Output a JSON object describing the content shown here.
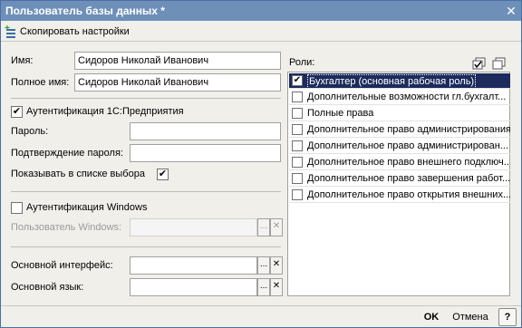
{
  "window": {
    "title": "Пользователь базы данных *",
    "close_glyph": "✕"
  },
  "toolbar": {
    "copy_label": "Скопировать настройки"
  },
  "form": {
    "name_label": "Имя:",
    "name_value": "Сидоров Николай Иванович",
    "fullname_label": "Полное имя:",
    "fullname_value": "Сидоров Николай Иванович",
    "auth_1c_label": "Аутентификация 1С:Предприятия",
    "auth_1c_checked": true,
    "password_label": "Пароль:",
    "password_value": "",
    "password_confirm_label": "Подтверждение пароля:",
    "password_confirm_value": "",
    "show_in_list_label": "Показывать в списке выбора",
    "show_in_list_checked": true,
    "auth_windows_label": "Аутентификация Windows",
    "auth_windows_checked": false,
    "windows_user_label": "Пользователь Windows:",
    "windows_user_value": "",
    "main_interface_label": "Основной интерфейс:",
    "main_interface_value": "",
    "main_language_label": "Основной язык:",
    "main_language_value": "",
    "select_glyph": "...",
    "clear_glyph": "✕",
    "check_glyph": "✔"
  },
  "roles": {
    "label": "Роли:",
    "items": [
      {
        "label": "Бухгалтер (основная рабочая роль)",
        "checked": true,
        "selected": true
      },
      {
        "label": "Дополнительные возможности гл.бухгалт...",
        "checked": false
      },
      {
        "label": "Полные права",
        "checked": false
      },
      {
        "label": "Дополнительное право администрирования",
        "checked": false
      },
      {
        "label": "Дополнительное право администрирован...",
        "checked": false
      },
      {
        "label": "Дополнительное право внешнего подключ...",
        "checked": false
      },
      {
        "label": "Дополнительное право завершения работ...",
        "checked": false
      },
      {
        "label": "Дополнительное право открытия внешних...",
        "checked": false
      }
    ]
  },
  "footer": {
    "ok_label": "OK",
    "cancel_label": "Отмена",
    "help_label": "?"
  }
}
